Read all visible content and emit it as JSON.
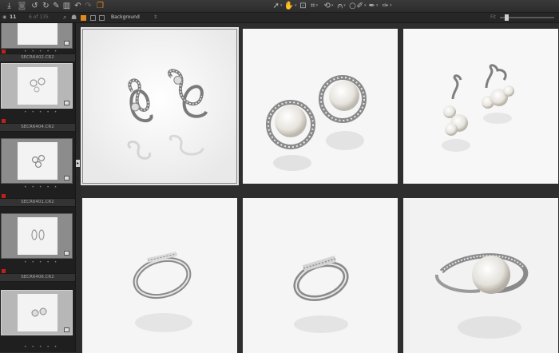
{
  "toolbar": {
    "left_icons": [
      "import-icon",
      "camera-icon",
      "recycle-icon",
      "rotate-left-icon",
      "rotate-right-icon",
      "edit-icon",
      "trash-icon",
      "undo-icon",
      "redo-icon",
      "stack-icon"
    ],
    "right_icons": [
      "cursor-icon",
      "pan-hand-icon",
      "loupe-icon",
      "crop-icon",
      "straighten-icon",
      "keystone-icon",
      "spot-icon",
      "brush-icon",
      "picker-icon",
      "erase-icon"
    ]
  },
  "subbar": {
    "count": "11",
    "range": "6 of 135",
    "background_option": "Background",
    "fit_label": "Fit"
  },
  "filmstrip": {
    "items": [
      {
        "label": "SECR6402.CR2",
        "dots": "• • • • •",
        "flag": true,
        "selected": false
      },
      {
        "label": "SECR6404.CR2",
        "dots": "• • • • •",
        "flag": true,
        "selected": true
      },
      {
        "label": "SECR6401.CR2",
        "dots": "• • • • •",
        "flag": true,
        "selected": false
      },
      {
        "label": "SECR6406.CR2",
        "dots": "• • • • •",
        "flag": true,
        "selected": false
      },
      {
        "label": "",
        "dots": "• • • • •",
        "flag": false,
        "selected": false
      }
    ]
  },
  "viewer": {
    "images": [
      {
        "subject": "infinity-earrings-image",
        "selected": true
      },
      {
        "subject": "pearl-stud-earrings-image",
        "selected": false
      },
      {
        "subject": "pearl-drop-earrings-image",
        "selected": false
      },
      {
        "subject": "diamond-band-ring-image",
        "selected": false
      },
      {
        "subject": "pave-ring-image",
        "selected": false
      },
      {
        "subject": "pearl-ring-image",
        "selected": false
      }
    ]
  },
  "colors": {
    "accent": "#e08a1e",
    "flag_red": "#c0201c",
    "background": "#2e2e2e"
  }
}
